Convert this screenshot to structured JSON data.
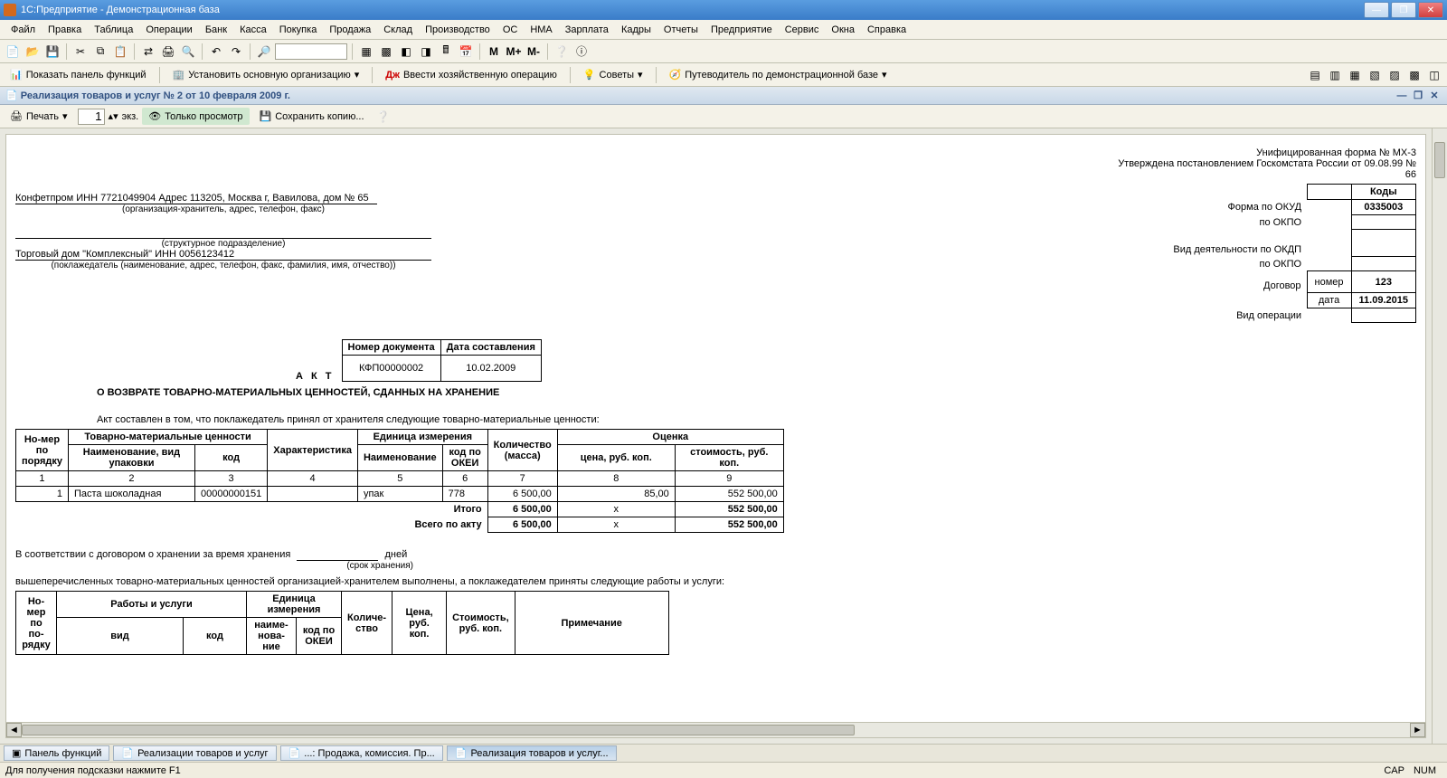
{
  "window": {
    "title": "1С:Предприятие - Демонстрационная база"
  },
  "menu": [
    "Файл",
    "Правка",
    "Таблица",
    "Операции",
    "Банк",
    "Касса",
    "Покупка",
    "Продажа",
    "Склад",
    "Производство",
    "ОС",
    "НМА",
    "Зарплата",
    "Кадры",
    "Отчеты",
    "Предприятие",
    "Сервис",
    "Окна",
    "Справка"
  ],
  "toolbar2": {
    "showPanel": "Показать панель функций",
    "setOrg": "Установить основную организацию",
    "enterOp": "Ввести хозяйственную операцию",
    "advice": "Советы",
    "guide": "Путеводитель по демонстрационной базе"
  },
  "docHeader": "Реализация товаров и услуг № 2 от 10 февраля 2009 г.",
  "docToolbar": {
    "print": "Печать",
    "copies": "1",
    "copiesLabel": "экз.",
    "viewOnly": "Только просмотр",
    "saveCopy": "Сохранить копию..."
  },
  "form": {
    "topr1": "Унифицированная форма № МХ-3",
    "topr2": "Утверждена постановлением Госкомстата России от 09.08.99 № 66",
    "codesHeader": "Коды",
    "codes": [
      {
        "label": "Форма по ОКУД",
        "val": "0335003"
      },
      {
        "label": "по ОКПО",
        "val": ""
      },
      {
        "label": "Вид деятельности по ОКДП",
        "val": ""
      },
      {
        "label": "по ОКПО",
        "val": ""
      },
      {
        "label": "Договор",
        "sub": "номер",
        "val": "123"
      },
      {
        "label": "",
        "sub": "дата",
        "val": "11.09.2015"
      },
      {
        "label": "Вид операции",
        "val": ""
      }
    ],
    "org": "Конфетпром ИНН 7721049904 Адрес 113205, Москва г, Вавилова, дом № 65",
    "orgSub": "(организация-хранитель, адрес, телефон, факс)",
    "structSub": "(структурное подразделение)",
    "depositor": "Торговый дом \"Комплексный\" ИНН 0056123412",
    "depositorSub": "(поклажедатель (наименование, адрес, телефон, факс, фамилия, имя, отчество))",
    "actLabel": "А К Т",
    "actCols": [
      "Номер документа",
      "Дата составления"
    ],
    "actVals": [
      "КФП00000002",
      "10.02.2009"
    ],
    "actTitle": "О ВОЗВРАТЕ ТОВАРНО-МАТЕРИАЛЬНЫХ ЦЕННОСТЕЙ, СДАННЫХ НА ХРАНЕНИЕ",
    "preamble": "Акт составлен в том, что поклажедатель принял от хранителя следующие товарно-материальные ценности:",
    "mainHeaders": {
      "num": "Но-мер по порядку",
      "tmc": "Товарно-материальные ценности",
      "name": "Наименование, вид упаковки",
      "code": "код",
      "char": "Характеристика",
      "unit": "Единица измерения",
      "unitName": "Наименование",
      "unitCode": "код по ОКЕИ",
      "qty": "Количество (масса)",
      "eval": "Оценка",
      "price": "цена, руб. коп.",
      "cost": "стоимость, руб. коп."
    },
    "colNums": [
      "1",
      "2",
      "3",
      "4",
      "5",
      "6",
      "7",
      "8",
      "9"
    ],
    "rows": [
      {
        "n": "1",
        "name": "Паста шоколадная",
        "code": "00000000151",
        "char": "",
        "uname": "упак",
        "ucode": "778",
        "qty": "6 500,00",
        "price": "85,00",
        "cost": "552 500,00"
      }
    ],
    "totals": {
      "itogo": "Итого",
      "vsego": "Всего по акту",
      "qty": "6 500,00",
      "x": "х",
      "cost": "552 500,00"
    },
    "afterText1": "В соответствии с договором о хранении за время хранения",
    "afterDays": "дней",
    "afterSrok": "(срок хранения)",
    "afterText2": "вышеперечисленных товарно-материальных ценностей организацией-хранителем выполнены, а поклажедателем приняты следующие работы и услуги:",
    "svcHeaders": {
      "num": "Но-мер по по-рядку",
      "svc": "Работы и услуги",
      "vid": "вид",
      "code": "код",
      "unit": "Единица измерения",
      "uname": "наиме-нова-ние",
      "ucode": "код по ОКЕИ",
      "qty": "Количе-ство",
      "price": "Цена, руб. коп.",
      "cost": "Стоимость, руб. коп.",
      "note": "Примечание"
    }
  },
  "tasks": [
    {
      "label": "Панель функций",
      "active": false
    },
    {
      "label": "Реализации товаров и услуг",
      "active": false
    },
    {
      "label": "...: Продажа, комиссия. Пр...",
      "active": false
    },
    {
      "label": "Реализация товаров и услуг...",
      "active": true
    }
  ],
  "status": {
    "hint": "Для получения подсказки нажмите F1",
    "cap": "CAP",
    "num": "NUM"
  }
}
